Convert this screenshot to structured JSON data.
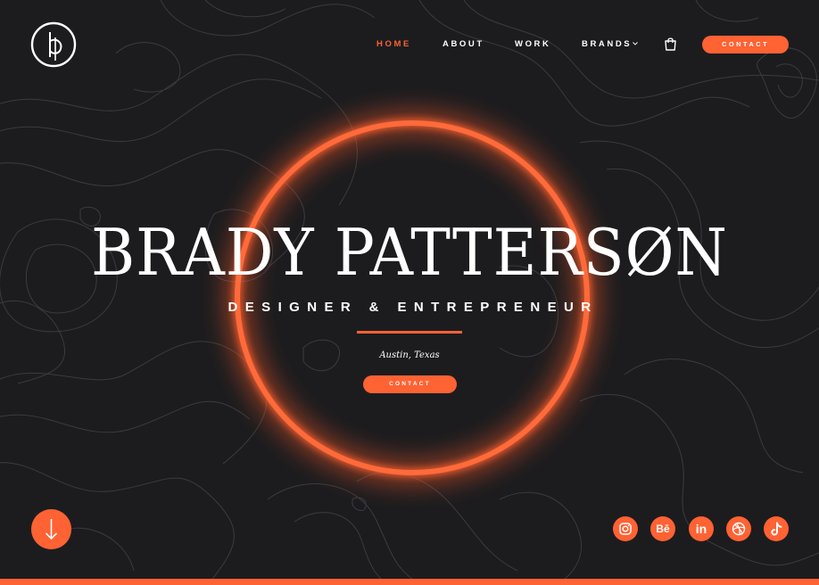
{
  "brand": {
    "logo_icon": "bp-monogram-logo"
  },
  "nav": {
    "items": [
      {
        "label": "HOME",
        "active": true
      },
      {
        "label": "ABOUT",
        "active": false
      },
      {
        "label": "WORK",
        "active": false
      },
      {
        "label": "BRANDS",
        "active": false,
        "has_dropdown": true
      }
    ],
    "cart_icon": "shopping-bag-icon",
    "contact_label": "CONTACT"
  },
  "hero": {
    "name": "BRADY PATTERSØN",
    "subtitle": "DESIGNER & ENTREPRENEUR",
    "location": "Austin, Texas",
    "cta_label": "CONTACT"
  },
  "scroll": {
    "icon": "arrow-down-icon"
  },
  "social": [
    {
      "name": "instagram-icon"
    },
    {
      "name": "behance-icon",
      "glyph": "Bē"
    },
    {
      "name": "linkedin-icon",
      "glyph": "in"
    },
    {
      "name": "dribbble-icon"
    },
    {
      "name": "tiktok-icon"
    }
  ],
  "colors": {
    "accent": "#ff6233",
    "background": "#1c1c1f",
    "text": "#ffffff",
    "contour": "#3c3c41"
  }
}
